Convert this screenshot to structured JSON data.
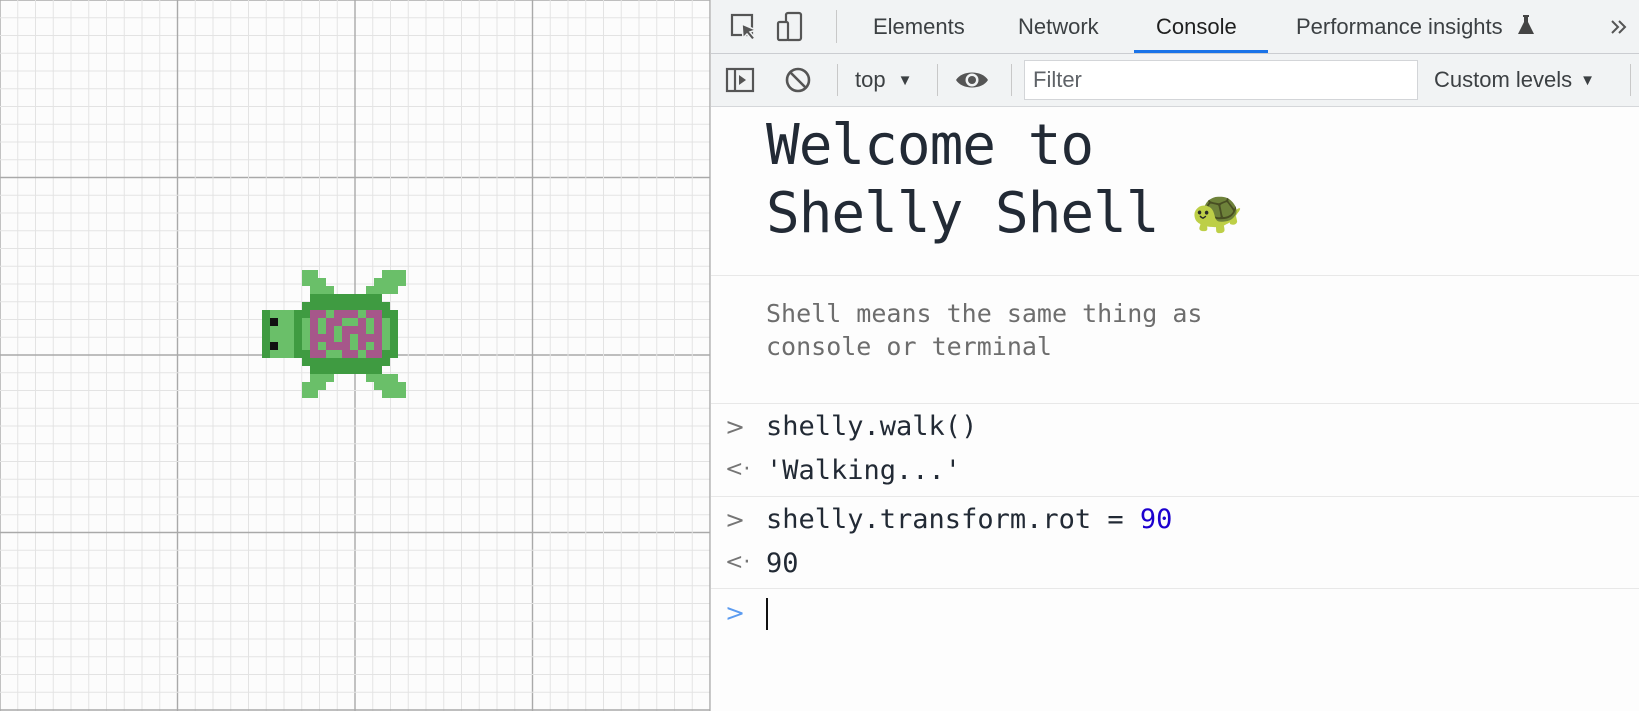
{
  "devtools": {
    "tabs": [
      {
        "label": "Elements"
      },
      {
        "label": "Network"
      },
      {
        "label": "Console"
      },
      {
        "label": "Performance insights"
      }
    ],
    "active_tab": "Console",
    "overflow_icon": "chevron-double-right-icon"
  },
  "toolbar": {
    "context": "top",
    "filter_placeholder": "Filter",
    "levels": "Custom levels"
  },
  "console": {
    "welcome_line1": "Welcome to",
    "welcome_line2": "Shelly Shell",
    "welcome_emoji": "🐢",
    "subtext_line1": "Shell means the same thing as",
    "subtext_line2": "console or terminal",
    "entries": [
      {
        "type": "input",
        "code": "shelly.walk()"
      },
      {
        "type": "output",
        "value": "'Walking...'"
      },
      {
        "type": "input",
        "code_prefix": "shelly.transform.rot = ",
        "code_value": "90"
      },
      {
        "type": "output",
        "value": "90"
      }
    ]
  },
  "colors": {
    "accent": "#1a73e8",
    "string": "#c80000",
    "number": "#1a1aa6",
    "turtle_light": "#6abf69",
    "turtle_dark": "#3f9b41",
    "shell_pink": "#a6578a"
  }
}
